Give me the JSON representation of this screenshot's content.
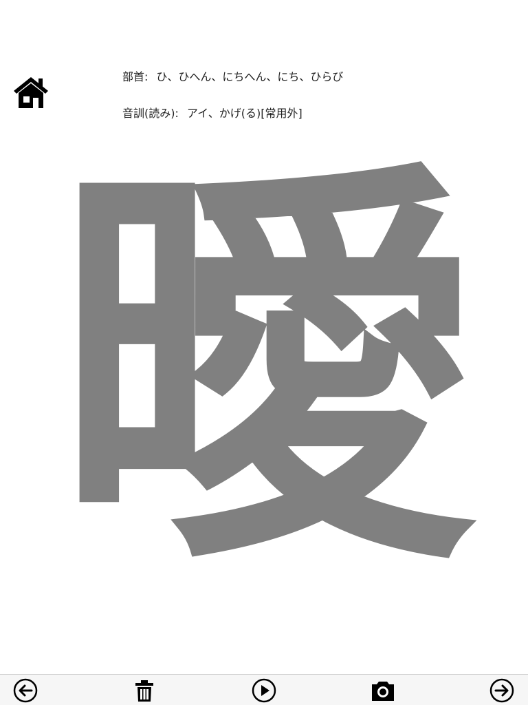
{
  "header": {
    "home_icon": "home-icon"
  },
  "kanji_info": {
    "radical_label": "部首:",
    "radical_value": "ひ、ひへん、にちへん、にち、ひらび",
    "reading_label": "音訓(読み):",
    "reading_value": "アイ、かげ(る)[常用外]"
  },
  "kanji": {
    "character": "曖",
    "color": "#808080"
  },
  "toolbar": {
    "icons": [
      "back-arrow-icon",
      "trash-icon",
      "play-icon",
      "camera-icon",
      "forward-arrow-icon"
    ]
  }
}
